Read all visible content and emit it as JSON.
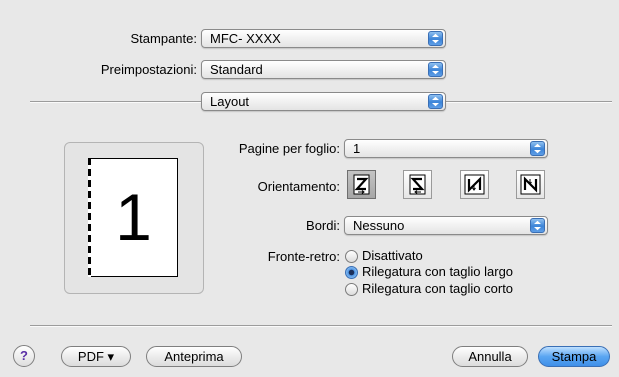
{
  "printer": {
    "label": "Stampante:",
    "value": "MFC- XXXX"
  },
  "presets": {
    "label": "Preimpostazioni:",
    "value": "Standard"
  },
  "panel": {
    "value": "Layout"
  },
  "preview": {
    "page_number": "1"
  },
  "layout": {
    "pages_per_sheet": {
      "label": "Pagine per foglio:",
      "value": "1"
    },
    "orientation": {
      "label": "Orientamento:",
      "selected_index": 0,
      "options": [
        "z-order-icon",
        "reverse-z-order-icon",
        "n-order-icon",
        "reverse-n-order-icon"
      ]
    },
    "border": {
      "label": "Bordi:",
      "value": "Nessuno"
    },
    "duplex": {
      "label": "Fronte-retro:",
      "options": [
        "Disattivato",
        "Rilegatura con taglio largo",
        "Rilegatura con taglio corto"
      ],
      "selected_index": 1
    }
  },
  "footer": {
    "help": "?",
    "pdf": "PDF ▾",
    "preview": "Anteprima",
    "cancel": "Annulla",
    "print": "Stampa"
  },
  "colors": {
    "accent": "#3f8fe8",
    "background": "#e8e8e8"
  }
}
